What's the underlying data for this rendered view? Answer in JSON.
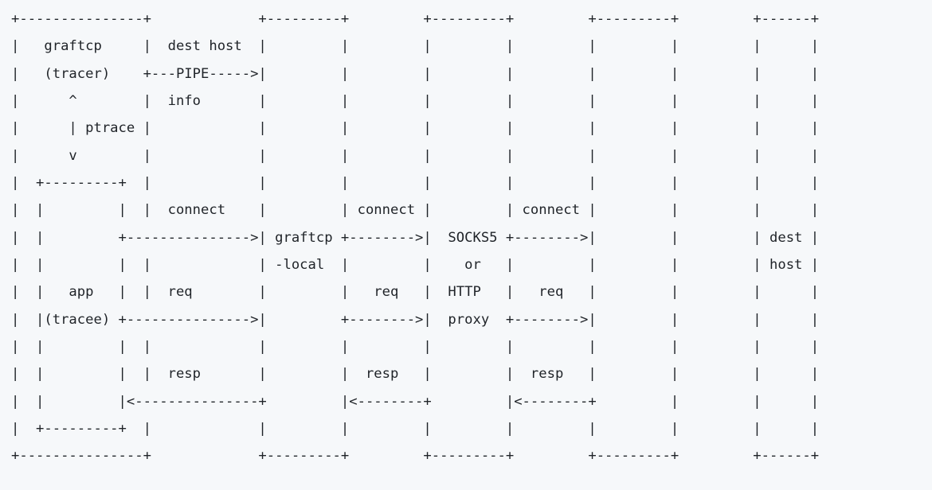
{
  "diagram": {
    "ascii": "+---------------+  +---------+         +---------+         +---------+         +------+\n|   graftcp     |  dest host|         |         |         |         |         |      |\n|   (tracer)    +---PIPE----->         |         |         |         |         |      |\n|      ^        |  info    |         |         |         |         |         |      |\n|      | ptrace |          |         |         |         |         |         |      |\n|      v        |          |         |         |         |         |         |      |\n|  +---------+  |          |         |         |         |         |         |      |\n|  |         |  |  connect |         | connect |         | connect |         |      |\n|  |         +-------------->| graftcp +--------->| SOCKS5  +--------->| dest |\n|  |         |  |          | -local  |         |   or    |         | host |\n|  |   app   |  |  req     |         |   req   |  HTTP   |   req   |      |\n|  |(tracee) +-------------->|         +--------->|  proxy  +--------->|      |\n|  |         |  |          |         |         |         |         |      |\n|  |         |  |  resp    |         |  resp   |         |  resp   |      |\n|  |         |<--------------+         |<---------+         |<---------+      |\n|  +---------+  |          |         |         |         |         |         |      |\n+---------------+  +---------+         +---------+         +---------+         +------+",
    "components": {
      "tracer": {
        "name": "graftcp",
        "role": "(tracer)"
      },
      "tracee": {
        "name": "app",
        "role": "(tracee)"
      },
      "link_tracer_tracee": "ptrace",
      "local_proxy": "graftcp-local",
      "remote_proxy": "SOCKS5 or HTTP proxy",
      "destination": "dest host"
    },
    "flows": [
      {
        "from": "graftcp (tracer)",
        "to": "graftcp-local",
        "label": "dest host info",
        "via": "PIPE"
      },
      {
        "from": "app (tracee)",
        "to": "graftcp-local",
        "label": "connect"
      },
      {
        "from": "graftcp-local",
        "to": "SOCKS5 or HTTP proxy",
        "label": "connect"
      },
      {
        "from": "SOCKS5 or HTTP proxy",
        "to": "dest host",
        "label": "connect"
      },
      {
        "from": "app (tracee)",
        "to": "graftcp-local",
        "label": "req"
      },
      {
        "from": "graftcp-local",
        "to": "SOCKS5 or HTTP proxy",
        "label": "req"
      },
      {
        "from": "SOCKS5 or HTTP proxy",
        "to": "dest host",
        "label": "req"
      },
      {
        "from": "graftcp-local",
        "to": "app (tracee)",
        "label": "resp"
      },
      {
        "from": "SOCKS5 or HTTP proxy",
        "to": "graftcp-local",
        "label": "resp"
      },
      {
        "from": "dest host",
        "to": "SOCKS5 or HTTP proxy",
        "label": "resp"
      }
    ]
  },
  "render_lines": [
    "+---------------+             +---------+         +---------+         +---------+         +------+",
    "|   graftcp     |  dest host  |         |         |         |         |         |         |      |",
    "|   (tracer)    +---PIPE----->|         |         |         |         |         |         |      |",
    "|      ^        |  info       |         |         |         |         |         |         |      |",
    "|      | ptrace |             |         |         |         |         |         |         |      |",
    "|      v        |             |         |         |         |         |         |         |      |",
    "|  +---------+  |             |         |         |         |         |         |         |      |",
    "|  |         |  |  connect    |         | connect |         | connect |         |         |      |",
    "|  |         +--------------->| graftcp +-------->|  SOCKS5 +-------->|         |         | dest |",
    "|  |         |  |             | -local  |         |    or   |         |         |         | host |",
    "|  |   app   |  |  req        |         |   req   |  HTTP   |   req   |         |         |      |",
    "|  |(tracee) +--------------->|         +-------->|  proxy  +-------->|         |         |      |",
    "|  |         |  |             |         |         |         |         |         |         |      |",
    "|  |         |  |  resp       |         |  resp   |         |  resp   |         |         |      |",
    "|  |         |<---------------+         |<--------+         |<--------+         |         |      |",
    "|  +---------+  |             |         |         |         |         |         |         |      |",
    "+---------------+             +---------+         +---------+         +---------+         +------+"
  ]
}
